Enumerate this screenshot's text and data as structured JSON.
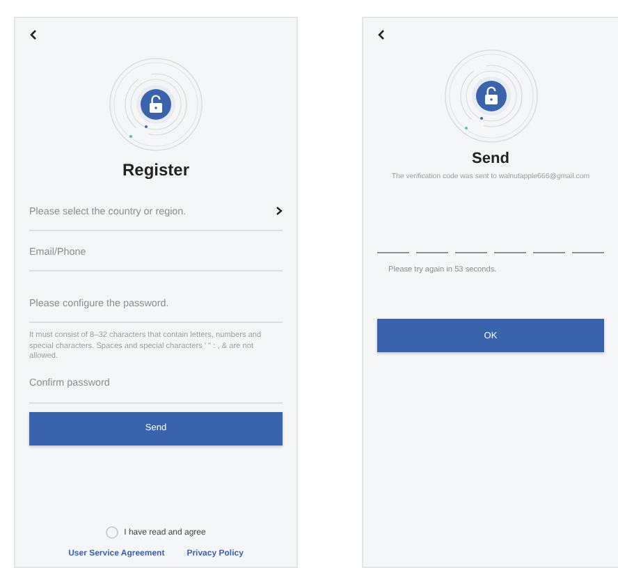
{
  "register": {
    "title": "Register",
    "fields": [
      {
        "kind": "select",
        "placeholder": "Please select the country or region."
      },
      {
        "kind": "input",
        "placeholder": "Email/Phone"
      },
      {
        "kind": "input",
        "placeholder": "Please configure the password."
      },
      {
        "kind": "hint",
        "text": "It must consist of 8–32 characters that contain letters, numbers and special characters. Spaces and special characters ' \" : , & are not allowed."
      },
      {
        "kind": "input",
        "placeholder": "Confirm password"
      }
    ],
    "button": "Send",
    "agree": {
      "label": "I have read and agree",
      "checked": false
    },
    "links": [
      "User Service Agreement",
      "Privacy Policy"
    ]
  },
  "send": {
    "title": "Send",
    "subtitle": "The verification code was sent to walnutapple666@gmail.com",
    "retry": "Please try again in 53 seconds.",
    "button": "OK"
  }
}
